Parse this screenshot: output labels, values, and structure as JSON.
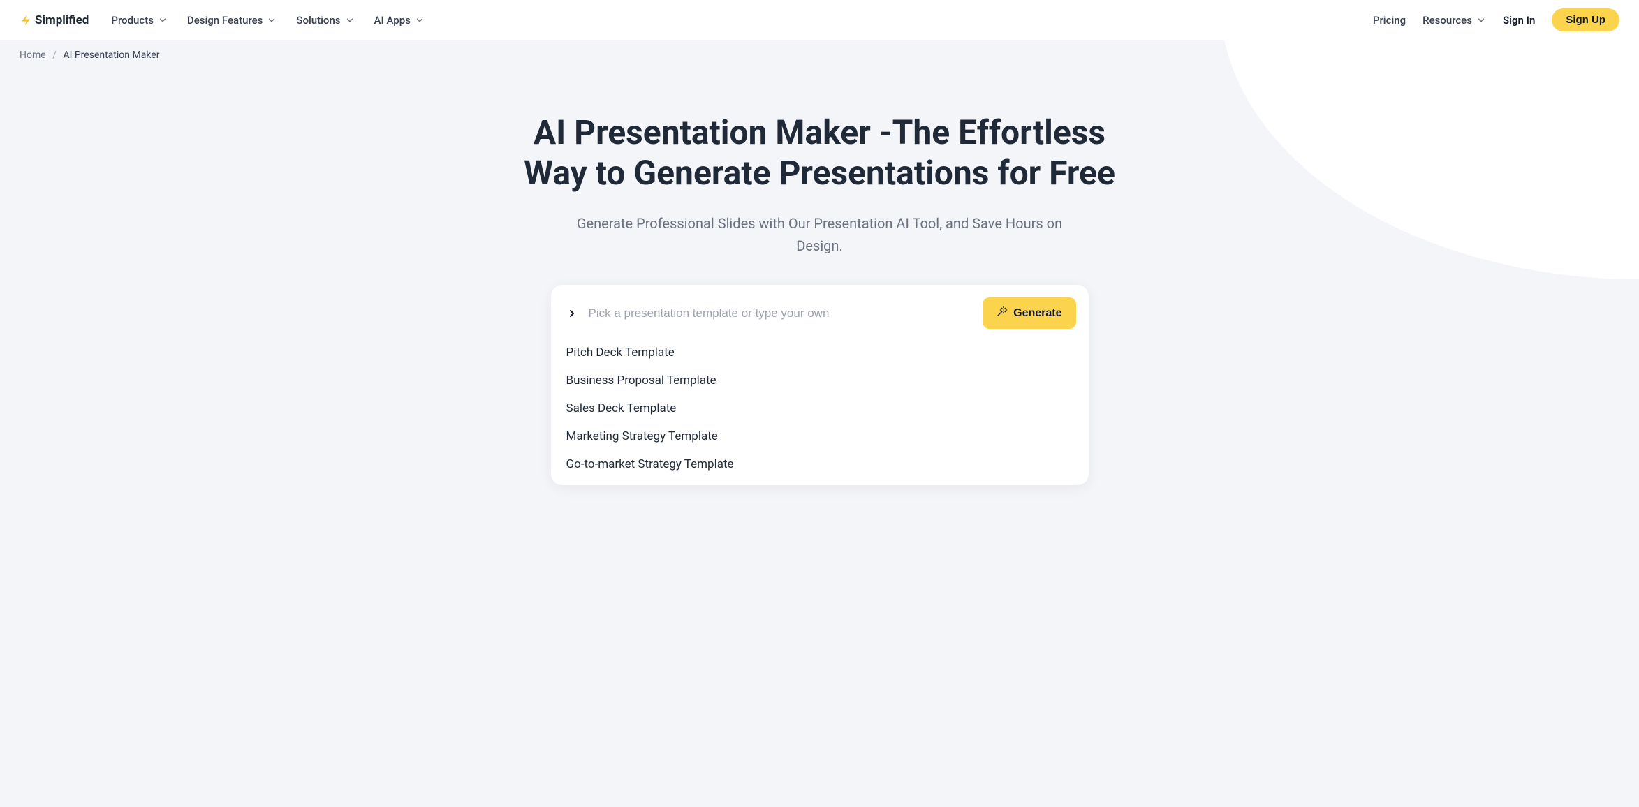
{
  "logo": {
    "text": "Simplified"
  },
  "nav": {
    "items": [
      {
        "label": "Products"
      },
      {
        "label": "Design Features"
      },
      {
        "label": "Solutions"
      },
      {
        "label": "AI Apps"
      }
    ]
  },
  "header_right": {
    "pricing": "Pricing",
    "resources": "Resources",
    "signin": "Sign In",
    "signup": "Sign Up"
  },
  "breadcrumb": {
    "home": "Home",
    "current": "AI Presentation Maker"
  },
  "hero": {
    "title": "AI Presentation Maker -The Effortless Way to Generate Presentations for Free",
    "subtitle": "Generate Professional Slides with Our Presentation AI Tool, and Save Hours on Design."
  },
  "prompt": {
    "placeholder": "Pick a presentation template or type your own",
    "generate_label": "Generate"
  },
  "templates": [
    "Pitch Deck Template",
    "Business Proposal Template",
    "Sales Deck Template",
    "Marketing Strategy Template",
    "Go-to-market Strategy Template"
  ]
}
